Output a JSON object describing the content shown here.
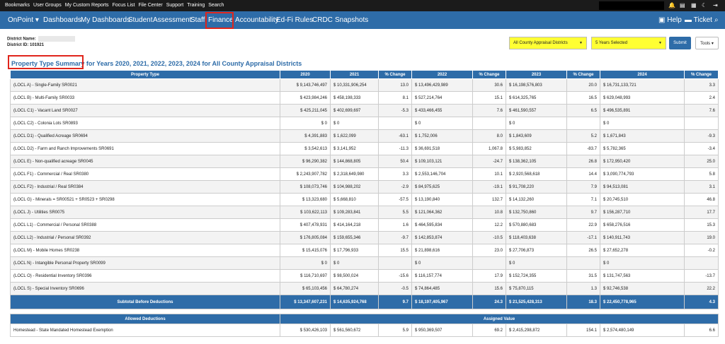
{
  "top_links": [
    "Bookmarks",
    "User Groups",
    "My Custom Reports",
    "Focus List",
    "File Center",
    "Support",
    "Training",
    "Search"
  ],
  "nav": {
    "brand": "OnPoint",
    "items": [
      "Dashboards",
      "My Dashboards",
      "Student",
      "Assessment",
      "Staff",
      "Finance",
      "Accountability",
      "Ed-Fi Rules",
      "CRDC",
      "Snapshots"
    ],
    "help": "Help",
    "ticket": "Ticket"
  },
  "district": {
    "name_label": "District Name:",
    "id_text": "District ID: 101921"
  },
  "filters": {
    "district_select": "All County Appraisal Districts",
    "years_select": "5 Years Selected",
    "submit": "Submit",
    "tools": "Tools"
  },
  "title": {
    "highlight": "Property Type Summary",
    "rest": " for Years 2020, 2021, 2022, 2023, 2024 for All County Appraisal Districts"
  },
  "table": {
    "headers": [
      "Property Type",
      "2020",
      "2021",
      "% Change",
      "2022",
      "% Change",
      "2023",
      "% Change",
      "2024",
      "% Change"
    ],
    "rows": [
      [
        "(LOCL A) - Single-Family SR0021",
        "$ 9,143,746,497",
        "$ 10,331,906,254",
        "13.0",
        "$ 13,496,429,989",
        "30.6",
        "$ 16,198,576,803",
        "20.0",
        "$ 16,731,133,721",
        "3.3"
      ],
      [
        "(LOCL B) - Multi-Family SR0033",
        "$ 423,984,246",
        "$ 458,198,333",
        "8.1",
        "$ 527,214,764",
        "15.1",
        "$ 614,325,765",
        "16.5",
        "$ 629,048,993",
        "2.4"
      ],
      [
        "(LOCL C1) - Vacant Land SR0027",
        "$ 425,211,045",
        "$ 402,699,697",
        "-5.3",
        "$ 433,466,455",
        "7.6",
        "$ 461,590,557",
        "6.5",
        "$ 496,535,891",
        "7.6"
      ],
      [
        "(LOCL C2) - Colonia Lots SR0893",
        "$ 0",
        "$ 0",
        "",
        "$ 0",
        "",
        "$ 0",
        "",
        "$ 0",
        ""
      ],
      [
        "(LOCL D1) - Qualified Acreage SR0694",
        "$ 4,391,883",
        "$ 1,622,099",
        "-63.1",
        "$ 1,752,006",
        "8.0",
        "$ 1,843,609",
        "5.2",
        "$ 1,671,843",
        "-9.3"
      ],
      [
        "(LOCL D2) - Farm and Ranch Improvements SR0691",
        "$ 3,542,613",
        "$ 3,141,952",
        "-11.3",
        "$ 36,691,518",
        "1,067.8",
        "$ 5,983,852",
        "-83.7",
        "$ 5,782,365",
        "-3.4"
      ],
      [
        "(LOCL E) - Non-qualified acreage SR0045",
        "$ 96,290,382",
        "$ 144,868,805",
        "50.4",
        "$ 109,103,121",
        "-24.7",
        "$ 138,362,105",
        "26.8",
        "$ 172,950,420",
        "25.0"
      ],
      [
        "(LOCL F1) - Commercial / Real SR0380",
        "$ 2,243,907,782",
        "$ 2,318,649,980",
        "3.3",
        "$ 2,553,146,704",
        "10.1",
        "$ 2,920,568,618",
        "14.4",
        "$ 3,090,774,793",
        "5.8"
      ],
      [
        "(LOCL F2) - Industrial / Real SR0384",
        "$ 108,073,746",
        "$ 104,988,202",
        "-2.9",
        "$ 84,975,625",
        "-19.1",
        "$ 91,708,220",
        "7.9",
        "$ 94,513,081",
        "3.1"
      ],
      [
        "(LOCL G) - Minerals = SR00521 + SR0523 + SR0298",
        "$ 13,323,680",
        "$ 5,668,810",
        "-57.5",
        "$ 13,190,840",
        "132.7",
        "$ 14,132,260",
        "7.1",
        "$ 20,745,510",
        "46.8"
      ],
      [
        "(LOCL J) - Utilities SR0075",
        "$ 103,622,113",
        "$ 109,283,841",
        "5.5",
        "$ 121,064,362",
        "10.8",
        "$ 132,750,860",
        "9.7",
        "$ 156,287,710",
        "17.7"
      ],
      [
        "(LOCL L1) - Commercial / Personal SR0388",
        "$ 407,478,931",
        "$ 414,164,218",
        "1.6",
        "$ 464,595,834",
        "12.2",
        "$ 570,880,683",
        "22.9",
        "$ 658,276,516",
        "15.3"
      ],
      [
        "(LOCL L2) - Industrial / Personal SR0392",
        "$ 176,805,084",
        "$ 159,655,346",
        "-9.7",
        "$ 142,853,874",
        "-10.5",
        "$ 118,403,638",
        "-17.1",
        "$ 140,911,743",
        "19.0"
      ],
      [
        "(LOCL M) - Mobile Homes SR0238",
        "$ 15,415,076",
        "$ 17,796,933",
        "15.5",
        "$ 21,898,616",
        "23.0",
        "$ 27,706,873",
        "26.5",
        "$ 27,652,278",
        "-0.2"
      ],
      [
        "(LOCL N) - Intangible Personal Property SR0099",
        "$ 0",
        "$ 0",
        "",
        "$ 0",
        "",
        "$ 0",
        "",
        "$ 0",
        ""
      ],
      [
        "(LOCL O) - Residential Inventory SR0396",
        "$ 116,710,697",
        "$ 98,500,024",
        "-15.6",
        "$ 116,157,774",
        "17.9",
        "$ 152,724,355",
        "31.5",
        "$ 131,747,563",
        "-13.7"
      ],
      [
        "(LOCL S) - Special Inventory SR0696",
        "$ 65,103,456",
        "$ 64,780,274",
        "-0.5",
        "$ 74,864,485",
        "15.6",
        "$ 75,870,115",
        "1.3",
        "$ 92,746,538",
        "22.2"
      ]
    ],
    "subtotal": [
      "Subtotal Before Deductions",
      "$ 13,347,607,231",
      "$ 14,635,924,768",
      "9.7",
      "$ 18,197,405,967",
      "24.3",
      "$ 21,525,428,313",
      "18.3",
      "$ 22,450,778,965",
      "4.3"
    ],
    "deductions_header": {
      "left": "Allowed Deductions",
      "right": "Assigned Value"
    },
    "homestead": [
      "Homestead - State Mandated Homestead Exemption",
      "$ 530,426,103",
      "$ 561,560,672",
      "5.9",
      "$ 950,369,507",
      "69.2",
      "$ 2,415,298,872",
      "154.1",
      "$ 2,574,480,149",
      "6.6"
    ]
  }
}
